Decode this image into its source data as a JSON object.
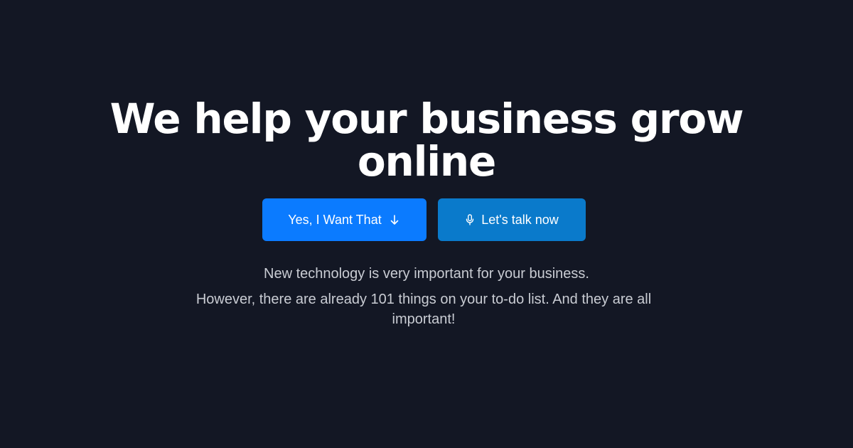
{
  "hero": {
    "headline_line1": "We help your business grow",
    "headline_line2": "online",
    "primary_cta": {
      "label": "Yes, I Want That",
      "icon": "arrow-down-icon",
      "color": "#0b7bff"
    },
    "secondary_cta": {
      "label": "Let's talk now",
      "icon": "microphone-icon",
      "color": "#0a7acb"
    },
    "intro": "New technology is very important for your business.",
    "body": "However, there are already 101 things on your to-do list. And they are all important!"
  },
  "theme": {
    "background": "#131724",
    "text": "#ffffff",
    "muted_text": "#c9ccd3"
  }
}
